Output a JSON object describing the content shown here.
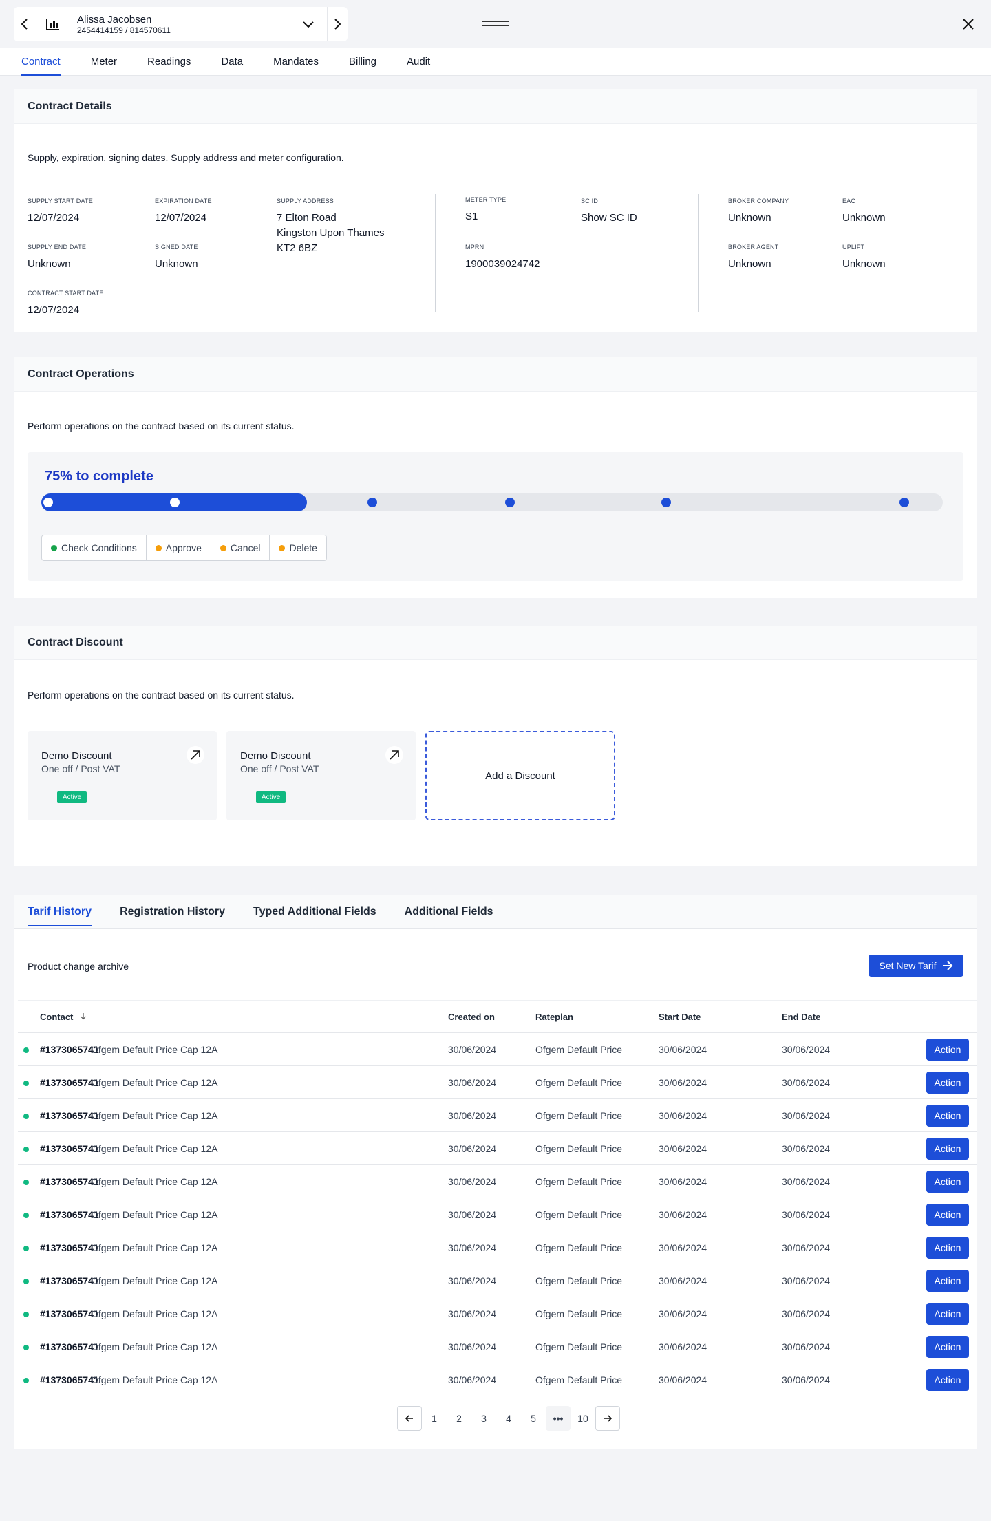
{
  "header": {
    "account_name": "Alissa Jacobsen",
    "account_number": "2454414159 / 814570611"
  },
  "main_tabs": [
    "Contract",
    "Meter",
    "Readings",
    "Data",
    "Mandates",
    "Billing",
    "Audit"
  ],
  "active_main_tab": "Contract",
  "contract_details": {
    "title": "Contract Details",
    "description": "Supply, expiration, signing dates. Supply address and meter configuration.",
    "supply_start_date": {
      "label": "SUPPLY START DATE",
      "value": "12/07/2024"
    },
    "expiration_date": {
      "label": "EXPIRATION DATE",
      "value": "12/07/2024"
    },
    "supply_address": {
      "label": "SUPPLY ADDRESS",
      "line1": "7 Elton Road",
      "line2": "Kingston Upon Thames",
      "line3": "KT2 6BZ"
    },
    "supply_end_date": {
      "label": "SUPPLY END DATE",
      "value": "Unknown"
    },
    "signed_date": {
      "label": "SIGNED DATE",
      "value": "Unknown"
    },
    "contract_start_date": {
      "label": "CONTRACT START DATE",
      "value": "12/07/2024"
    },
    "meter_type": {
      "label": "METER TYPE",
      "value": "S1"
    },
    "sc_id": {
      "label": "SC ID",
      "value": "Show SC ID"
    },
    "mprn": {
      "label": "MPRN",
      "value": "1900039024742"
    },
    "broker_company": {
      "label": "BROKER COMPANY",
      "value": "Unknown"
    },
    "eac": {
      "label": "EAC",
      "value": "Unknown"
    },
    "broker_agent": {
      "label": "BROKER AGENT",
      "value": "Unknown"
    },
    "uplift": {
      "label": "UPLIFT",
      "value": "Unknown"
    }
  },
  "contract_operations": {
    "title": "Contract Operations",
    "description": "Perform operations on the contract based on its current status.",
    "progress_label": "75% to complete",
    "progress_fraction": 0.295,
    "steps": [
      {
        "position": 0.008,
        "done": true
      },
      {
        "position": 0.148,
        "done": true
      },
      {
        "position": 0.367,
        "done": false
      },
      {
        "position": 0.52,
        "done": false
      },
      {
        "position": 0.693,
        "done": false
      },
      {
        "position": 0.957,
        "done": false
      }
    ],
    "buttons": [
      {
        "label": "Check Conditions",
        "color": "#16a34a"
      },
      {
        "label": "Approve",
        "color": "#f59e0b"
      },
      {
        "label": "Cancel",
        "color": "#f59e0b"
      },
      {
        "label": "Delete",
        "color": "#f59e0b"
      }
    ]
  },
  "contract_discount": {
    "title": "Contract Discount",
    "description": "Perform operations on the contract based on its current status.",
    "discounts": [
      {
        "name": "Demo Discount",
        "type": "One off / Post VAT",
        "status": "Active"
      },
      {
        "name": "Demo Discount",
        "type": "One off / Post VAT",
        "status": "Active"
      }
    ],
    "add_label": "Add a Discount"
  },
  "tarif_section": {
    "tabs": [
      "Tarif History",
      "Registration History",
      "Typed Additional Fields",
      "Additional Fields"
    ],
    "active_tab": "Tarif History",
    "description": "Product change archive",
    "set_button": "Set New Tarif",
    "columns": [
      "Contact",
      "Created on",
      "Rateplan",
      "Start Date",
      "End Date"
    ],
    "action_label": "Action",
    "status_color": "#10b981",
    "rows": [
      {
        "id": "#1373065741",
        "product": "Ofgem Default Price Cap 12A",
        "created": "30/06/2024",
        "rateplan": "Ofgem Default Price",
        "start": "30/06/2024",
        "end": "30/06/2024"
      },
      {
        "id": "#1373065741",
        "product": "Ofgem Default Price Cap 12A",
        "created": "30/06/2024",
        "rateplan": "Ofgem Default Price",
        "start": "30/06/2024",
        "end": "30/06/2024"
      },
      {
        "id": "#1373065741",
        "product": "Ofgem Default Price Cap 12A",
        "created": "30/06/2024",
        "rateplan": "Ofgem Default Price",
        "start": "30/06/2024",
        "end": "30/06/2024"
      },
      {
        "id": "#1373065741",
        "product": "Ofgem Default Price Cap 12A",
        "created": "30/06/2024",
        "rateplan": "Ofgem Default Price",
        "start": "30/06/2024",
        "end": "30/06/2024"
      },
      {
        "id": "#1373065741",
        "product": "Ofgem Default Price Cap 12A",
        "created": "30/06/2024",
        "rateplan": "Ofgem Default Price",
        "start": "30/06/2024",
        "end": "30/06/2024"
      },
      {
        "id": "#1373065741",
        "product": "Ofgem Default Price Cap 12A",
        "created": "30/06/2024",
        "rateplan": "Ofgem Default Price",
        "start": "30/06/2024",
        "end": "30/06/2024"
      },
      {
        "id": "#1373065741",
        "product": "Ofgem Default Price Cap 12A",
        "created": "30/06/2024",
        "rateplan": "Ofgem Default Price",
        "start": "30/06/2024",
        "end": "30/06/2024"
      },
      {
        "id": "#1373065741",
        "product": "Ofgem Default Price Cap 12A",
        "created": "30/06/2024",
        "rateplan": "Ofgem Default Price",
        "start": "30/06/2024",
        "end": "30/06/2024"
      },
      {
        "id": "#1373065741",
        "product": "Ofgem Default Price Cap 12A",
        "created": "30/06/2024",
        "rateplan": "Ofgem Default Price",
        "start": "30/06/2024",
        "end": "30/06/2024"
      },
      {
        "id": "#1373065741",
        "product": "Ofgem Default Price Cap 12A",
        "created": "30/06/2024",
        "rateplan": "Ofgem Default Price",
        "start": "30/06/2024",
        "end": "30/06/2024"
      },
      {
        "id": "#1373065741",
        "product": "Ofgem Default Price Cap 12A",
        "created": "30/06/2024",
        "rateplan": "Ofgem Default Price",
        "start": "30/06/2024",
        "end": "30/06/2024"
      }
    ],
    "pagination": [
      "1",
      "2",
      "3",
      "4",
      "5",
      "•••",
      "10"
    ]
  },
  "colors": {
    "accent": "#1d4ed8",
    "success": "#10b981",
    "warning": "#f59e0b"
  }
}
